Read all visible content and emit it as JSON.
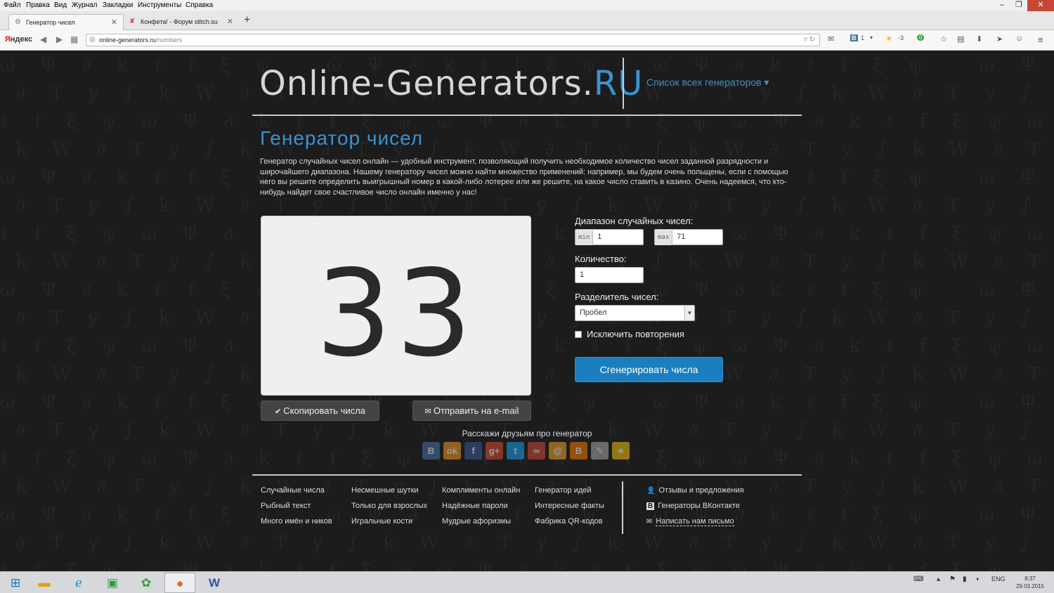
{
  "menubar": [
    "Файл",
    "Правка",
    "Вид",
    "Журнал",
    "Закладки",
    "Инструменты",
    "Справка"
  ],
  "window": {
    "minimize": "–",
    "restore": "❐",
    "close": "✕"
  },
  "tabs": [
    {
      "title": "Генератор чисел",
      "active": true,
      "icon": "gear-icon"
    },
    {
      "title": "Конфета! - Форум stitch.su",
      "active": false,
      "icon": "x-icon"
    }
  ],
  "newtab": "+",
  "navbar": {
    "yandex_y": "Я",
    "yandex_rest": "ндекс",
    "url_host": "online-generators.ru",
    "url_path": "/numbers",
    "vk_count": "1",
    "weather": "-3",
    "badge": "0"
  },
  "site": {
    "logo_main": "Online-Generators.",
    "logo_ru": "RU",
    "all_generators": "Список всех генераторов ▾"
  },
  "content": {
    "title": "Генератор чисел",
    "intro": "Генератор случайных чисел онлайн — удобный инструмент, позволяющий получить необходимое количество чисел заданной разрядности и широчайшего диапазона. Нашему генератору чисел можно найти множество применений: например, мы будем очень польщены, если с помощью него вы решите определить выигрышный номер в какой-либо лотерее или же решите, на какое число ставить в казино. Очень надеемся, что кто-нибудь найдет свое счастливое число онлайн именно у нас!",
    "result": "33",
    "copy_button": "Скопировать числа",
    "email_button": "Отправить на e-mail",
    "share_label": "Расскажи друзьям про генератор"
  },
  "form": {
    "range_label": "Диапазон случайных чисел:",
    "min_tag": "min",
    "min_value": "1",
    "max_tag": "max",
    "max_value": "71",
    "count_label": "Количество:",
    "count_value": "1",
    "separator_label": "Разделитель чисел:",
    "separator_value": "Пробел",
    "exclude_label": "Исключить повторения",
    "exclude_checked": false,
    "generate_button": "Сгенерировать числа"
  },
  "social": [
    {
      "name": "vk",
      "glyph": "B",
      "color": "#4a76a8"
    },
    {
      "name": "odnoklassniki",
      "glyph": "ok",
      "color": "#f59a23"
    },
    {
      "name": "facebook",
      "glyph": "f",
      "color": "#3b5998"
    },
    {
      "name": "google-plus",
      "glyph": "g+",
      "color": "#dd4b39"
    },
    {
      "name": "twitter",
      "glyph": "t",
      "color": "#1da1f2"
    },
    {
      "name": "moi-krug",
      "glyph": "∞",
      "color": "#d04b3b"
    },
    {
      "name": "mail",
      "glyph": "@",
      "color": "#f0a32a"
    },
    {
      "name": "blogger",
      "glyph": "B",
      "color": "#f57d00"
    },
    {
      "name": "livejournal",
      "glyph": "✎",
      "color": "#aaaaaa"
    },
    {
      "name": "bookmarks",
      "glyph": "★",
      "color": "#f4c20d"
    }
  ],
  "footer": {
    "col1": [
      "Случайные числа",
      "Рыбный текст",
      "Много имён и ников"
    ],
    "col2": [
      "Несмешные шутки",
      "Только для взрослых",
      "Игральные кости"
    ],
    "col3": [
      "Комплименты онлайн",
      "Надёжные пароли",
      "Мудрые афоризмы"
    ],
    "col4": [
      "Генератор идей",
      "Интересные факты",
      "Фабрика QR-кодов"
    ],
    "feedback": "Отзывы и предложения",
    "vk_generators": "Генераторы ВКонтакте",
    "write_us": "Написать нам письмо"
  },
  "taskbar": {
    "lang": "ENG",
    "time": "8:37",
    "date": "29.03.2015"
  },
  "colors": {
    "accent": "#3a93cd",
    "generate": "#1a7fc1",
    "background": "#1c1c1c"
  }
}
